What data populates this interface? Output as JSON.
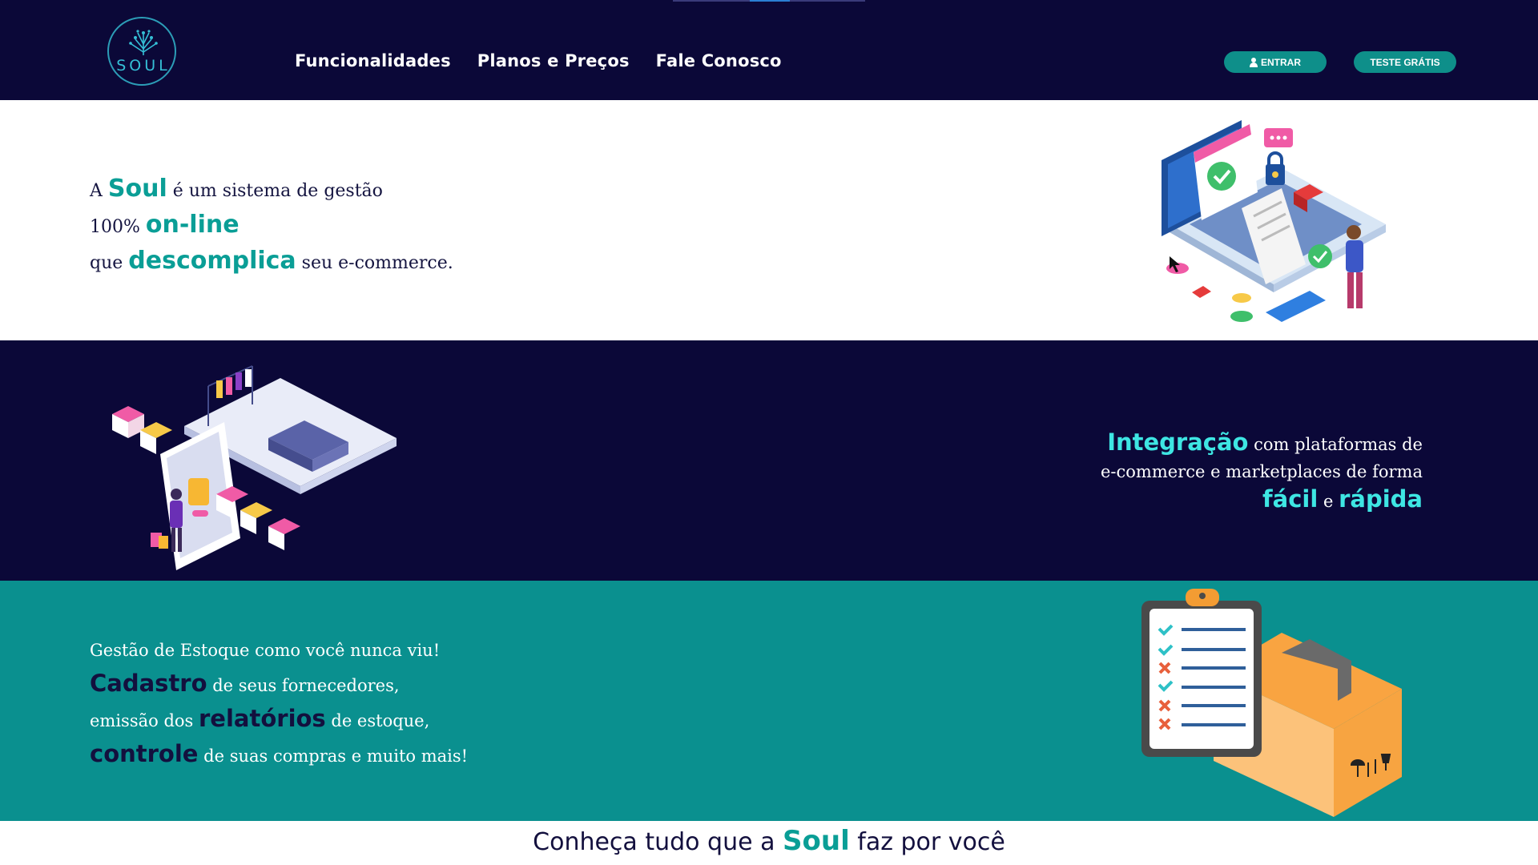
{
  "header": {
    "logo_text": "SOUL",
    "nav": [
      {
        "label": "Funcionalidades"
      },
      {
        "label": "Planos e Preços"
      },
      {
        "label": "Fale Conosco"
      }
    ],
    "login_label": "ENTRAR",
    "trial_label": "TESTE GRÁTIS"
  },
  "hero": {
    "line1_a": "A ",
    "line1_brand": "Soul",
    "line1_b": " é um sistema de gestão",
    "line2_a": "100% ",
    "line2_hl": "on-line",
    "line3_a": "que ",
    "line3_hl": "descomplica",
    "line3_b": " seu e-commerce.",
    "illustration": "ecommerce-laptop-illustration"
  },
  "integration": {
    "line1_hl": "Integração",
    "line1_b": " com plataformas de",
    "line2": "e-commerce e marketplaces de forma",
    "line3_hl1": "fácil",
    "line3_mid": " e ",
    "line3_hl2": "rápida",
    "illustration": "marketplace-phone-illustration"
  },
  "stock": {
    "line1": "Gestão de Estoque como você nunca viu!",
    "line2_hl": "Cadastro",
    "line2_b": " de seus fornecedores,",
    "line3_a": "emissão dos ",
    "line3_hl": "relatórios",
    "line3_b": " de estoque,",
    "line4_hl": "controle",
    "line4_b": " de suas compras e muito mais!",
    "illustration": "clipboard-box-illustration"
  },
  "footer_teaser": {
    "text_a": "Conheça tudo que a ",
    "brand": "Soul",
    "text_b": " faz por você"
  },
  "colors": {
    "navy": "#0b0838",
    "teal": "#0a908f",
    "accent_teal": "#0a9e96",
    "accent_cyan": "#3ee6e3"
  }
}
